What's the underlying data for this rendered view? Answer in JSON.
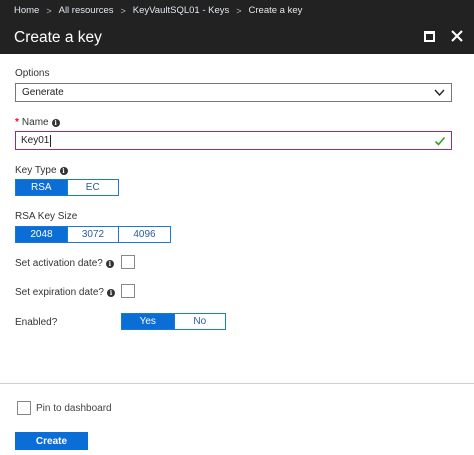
{
  "breadcrumb": {
    "items": [
      "Home",
      "All resources",
      "KeyVaultSQL01 - Keys"
    ],
    "current": "Create a key"
  },
  "header": {
    "title": "Create a key"
  },
  "form": {
    "options": {
      "label": "Options",
      "value": "Generate"
    },
    "name": {
      "label": "Name",
      "value": "Key01",
      "required": true
    },
    "key_type": {
      "label": "Key Type",
      "options": [
        "RSA",
        "EC"
      ],
      "selected": "RSA"
    },
    "rsa_key_size": {
      "label": "RSA Key Size",
      "options": [
        "2048",
        "3072",
        "4096"
      ],
      "selected": "2048"
    },
    "activation": {
      "label": "Set activation date?",
      "checked": false
    },
    "expiration": {
      "label": "Set expiration date?",
      "checked": false
    },
    "enabled": {
      "label": "Enabled?",
      "options": [
        "Yes",
        "No"
      ],
      "selected": "Yes"
    }
  },
  "footer": {
    "pin_label": "Pin to dashboard",
    "pin_checked": false,
    "create_label": "Create"
  },
  "colors": {
    "accent": "#0b6ed6",
    "header_bg": "#222222",
    "input_focus": "#8a2da8",
    "valid_check": "#3c9a26",
    "required": "#e81123"
  }
}
